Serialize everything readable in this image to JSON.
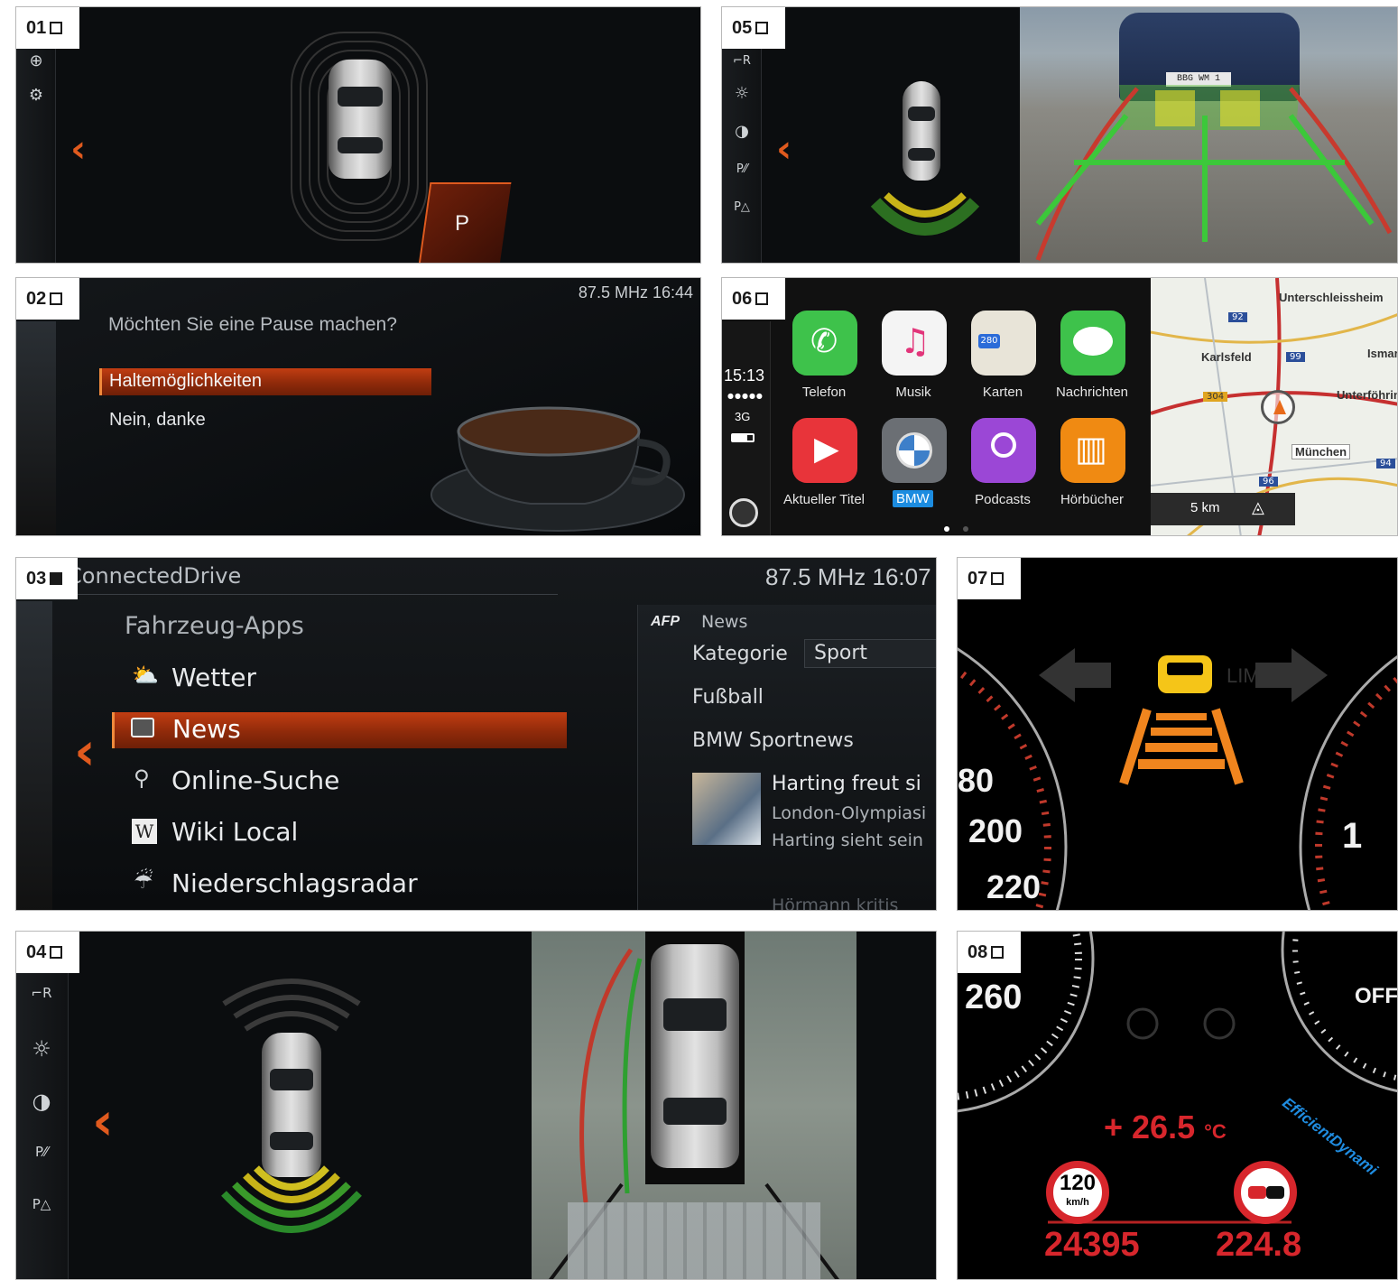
{
  "panels": {
    "p01": {
      "number": "01",
      "gear": "P"
    },
    "p02": {
      "number": "02",
      "status": "87.5 MHz  16:44",
      "question": "Möchten Sie eine Pause machen?",
      "options": [
        "Haltemöglichkeiten",
        "Nein, danke"
      ]
    },
    "p03": {
      "number": "03",
      "header": "ConnectedDrive",
      "status": "87.5 MHz  16:07",
      "section_title": "Fahrzeug-Apps",
      "menu": [
        {
          "label": "Wetter",
          "icon": "weather-icon"
        },
        {
          "label": "News",
          "icon": "news-icon",
          "selected": true
        },
        {
          "label": "Online-Suche",
          "icon": "location-search-icon"
        },
        {
          "label": "Wiki Local",
          "icon": "wiki-icon"
        },
        {
          "label": "Niederschlagsradar",
          "icon": "rain-radar-icon"
        }
      ],
      "news_source_logo": "AFP",
      "news_source": "News",
      "category_label": "Kategorie",
      "category_value": "Sport",
      "feed_items": [
        "Fußball",
        "BMW Sportnews"
      ],
      "article_lines": [
        "Harting freut si",
        "London-Olympiasi",
        "Harting sieht sein"
      ],
      "article_next": "Hörmann kritis"
    },
    "p04": {
      "number": "04"
    },
    "p05": {
      "number": "05",
      "plate": "BBG WM 1"
    },
    "p06": {
      "number": "06",
      "time": "15:13",
      "network": "3G",
      "apps": [
        {
          "label": "Telefon",
          "color": "#3ec24b"
        },
        {
          "label": "Musik",
          "color": "#f4f4f4"
        },
        {
          "label": "Karten",
          "color": "#e8e4d8"
        },
        {
          "label": "Nachrichten",
          "color": "#3ec24b"
        },
        {
          "label": "Aktueller Titel",
          "color": "#e8343a"
        },
        {
          "label": "BMW",
          "color": "#6b6f74"
        },
        {
          "label": "Podcasts",
          "color": "#9b47d6"
        },
        {
          "label": "Hörbücher",
          "color": "#f08a12"
        }
      ],
      "map_places": [
        "Unterschleissheim",
        "Karlsfeld",
        "Ismar",
        "Unterföhrin",
        "München"
      ],
      "map_roads": [
        "92",
        "99",
        "304",
        "96",
        "94"
      ],
      "map_badge": "280",
      "scale": "5 km"
    },
    "p07": {
      "number": "07",
      "speeds": [
        "80",
        "200",
        "220"
      ],
      "right_num": "1",
      "lim": "LIM"
    },
    "p08": {
      "number": "08",
      "speed": "260",
      "off": "OFF",
      "brand": "EfficientDynami",
      "temp": "+ 26.5",
      "temp_unit": "°C",
      "sign_speed": "120",
      "sign_unit": "km/h",
      "odometer": "24395",
      "trip": "224.8"
    }
  }
}
